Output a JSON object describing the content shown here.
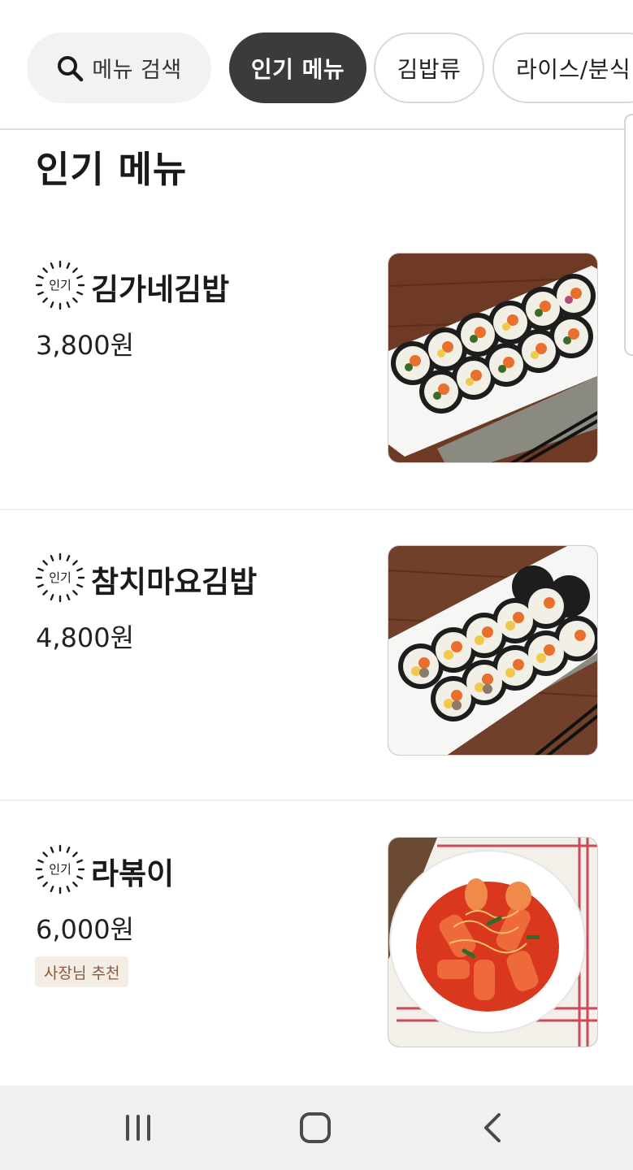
{
  "categories": {
    "search_label": "메뉴 검색",
    "search_icon": "search-icon",
    "chips": [
      {
        "label": "인기 메뉴",
        "active": true
      },
      {
        "label": "김밥류",
        "active": false
      },
      {
        "label": "라이스/분식",
        "active": false
      }
    ]
  },
  "section": {
    "title": "인기 메뉴"
  },
  "badge": {
    "text": "인기"
  },
  "items": [
    {
      "name": "김가네김밥",
      "price": "3,800원",
      "badge": true,
      "image": "gimbap-photo"
    },
    {
      "name": "참치마요김밥",
      "price": "4,800원",
      "badge": true,
      "image": "tuna-mayo-gimbap-photo"
    },
    {
      "name": "라볶이",
      "price": "6,000원",
      "badge": true,
      "tag": "사장님 추천",
      "image": "rabokki-photo"
    }
  ],
  "nav": {
    "recent_icon": "recent-apps-icon",
    "home_icon": "home-icon",
    "back_icon": "back-icon"
  },
  "colors": {
    "active_chip": "#3b3b3b",
    "tag_bg": "#f4ede6",
    "tag_text": "#8a5a3a",
    "navbar": "#f0f0f0"
  }
}
